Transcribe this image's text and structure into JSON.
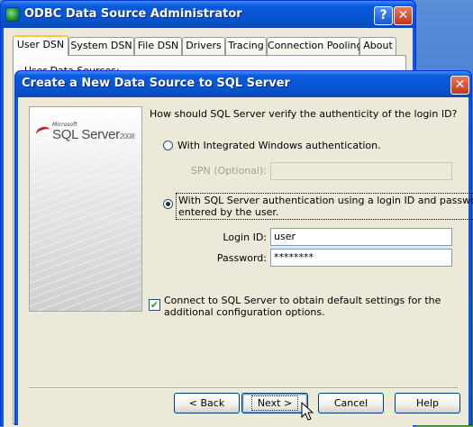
{
  "background_window": {
    "title": "ODBC Data Source Administrator",
    "help_glyph": "?",
    "close_glyph": "✕",
    "tabs": [
      {
        "label": "User DSN",
        "active": true
      },
      {
        "label": "System DSN",
        "active": false
      },
      {
        "label": "File DSN",
        "active": false
      },
      {
        "label": "Drivers",
        "active": false
      },
      {
        "label": "Tracing",
        "active": false
      },
      {
        "label": "Connection Pooling",
        "active": false
      },
      {
        "label": "About",
        "active": false
      }
    ],
    "panel_label": "User Data Sources:"
  },
  "dialog": {
    "title": "Create a New Data Source to SQL Server",
    "close_glyph": "✕",
    "brand": {
      "microsoft_text": "Microsoft",
      "product_text": "SQL Server",
      "year_text": "2008"
    },
    "question": "How should SQL Server verify the authenticity of the login ID?",
    "auth_options": {
      "windows": {
        "label": "With Integrated Windows authentication.",
        "selected": false
      },
      "sql": {
        "label_line1": "With SQL Server authentication using a login ID and password",
        "label_line2": "entered by the user.",
        "selected": true
      }
    },
    "spn": {
      "label": "SPN (Optional):",
      "value": "",
      "disabled": true
    },
    "login_id": {
      "label": "Login ID:",
      "value": "user"
    },
    "password": {
      "label": "Password:",
      "value": "********"
    },
    "connect_checkbox": {
      "checked": true,
      "check_glyph": "✔",
      "label_line1": "Connect to SQL Server to obtain default settings for the",
      "label_line2": "additional configuration options."
    },
    "buttons": {
      "back": "< Back",
      "next": "Next >",
      "cancel": "Cancel",
      "help": "Help"
    }
  },
  "colors": {
    "xp_title_blue": "#0a5ade",
    "dialog_face": "#ece9d8",
    "tab_highlight": "#ffc83c",
    "close_red": "#c2361a"
  }
}
